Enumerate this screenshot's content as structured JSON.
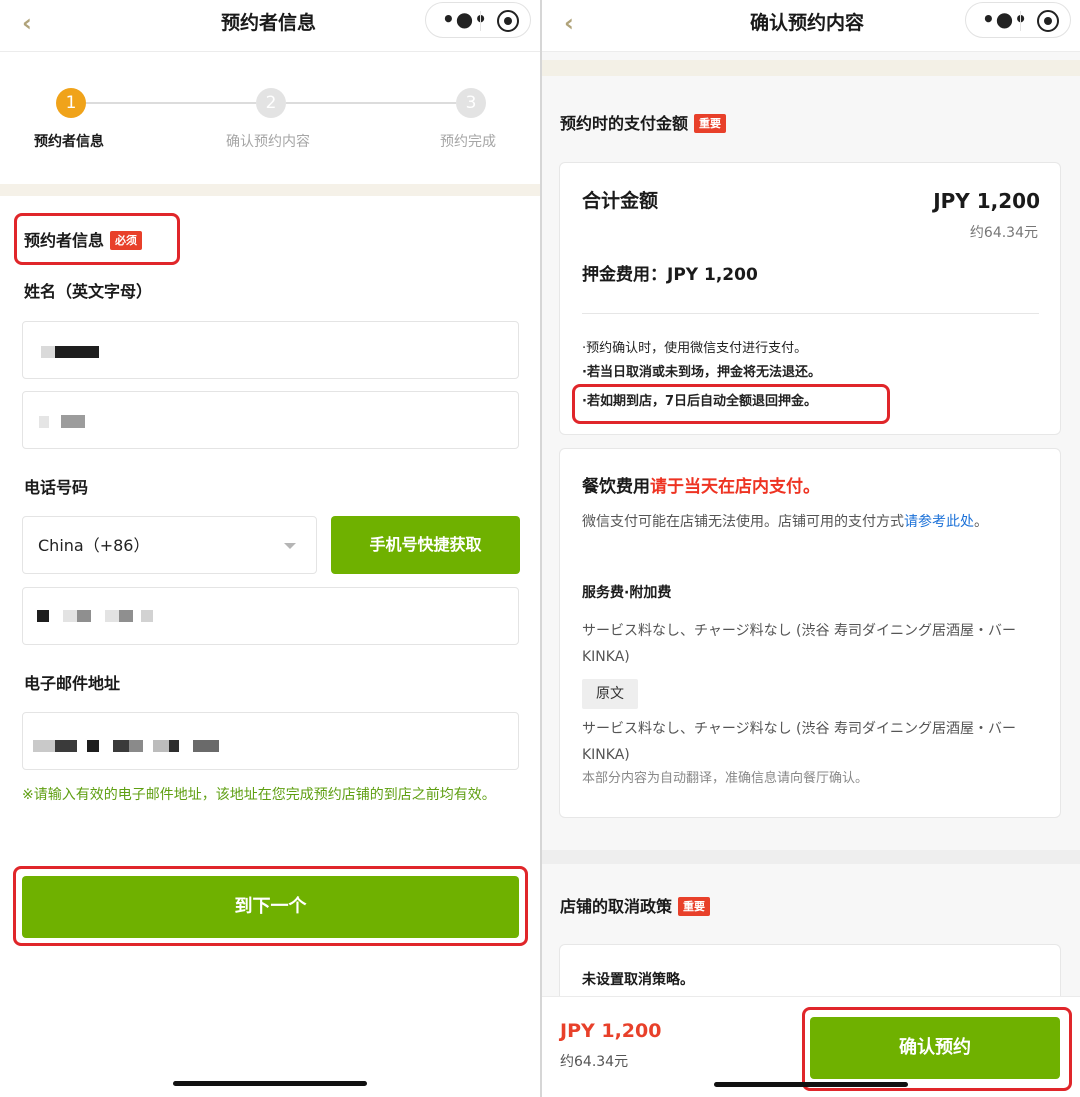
{
  "left": {
    "nav_title": "预约者信息",
    "steps": [
      {
        "num": "1",
        "label": "预约者信息",
        "active": true
      },
      {
        "num": "2",
        "label": "确认预约内容",
        "active": false
      },
      {
        "num": "3",
        "label": "预约完成",
        "active": false
      }
    ],
    "booker_section_title": "预约者信息",
    "required_tag": "必须",
    "name_label": "姓名（英文字母）",
    "phone_label": "电话号码",
    "country_code_value": "China（+86）",
    "quick_phone_button": "手机号快捷获取",
    "email_label": "电子邮件地址",
    "email_note": "※请输入有效的电子邮件地址，该地址在您完成预约店铺的到店之前均有效。",
    "next_button": "到下一个"
  },
  "right": {
    "nav_title": "确认预约内容",
    "payment_section_title": "预约时的支付金额",
    "important_tag": "重要",
    "total_label": "合计金额",
    "total_value": "JPY 1,200",
    "total_cny": "约64.34元",
    "deposit_label": "押金费用：JPY 1,200",
    "notes": [
      "·预约确认时，使用微信支付进行支付。",
      "·若当日取消或未到场，押金将无法退还。",
      "·若如期到店，7日后自动全额退回押金。"
    ],
    "food_fee_label": "餐饮费用",
    "food_fee_red": "请于当天在店内支付。",
    "wechat_note": "微信支付可能在店铺无法使用。店铺可用的支付方式",
    "wechat_link": "请参考此处",
    "wechat_note_end": "。",
    "service_fee_title": "服务费·附加费",
    "service_fee_text": "サービス料なし、チャージ料なし (渋谷 寿司ダイニング居酒屋・バーKINKA)",
    "original_button": "原文",
    "service_fee_original": "サービス料なし、チャージ料なし (渋谷 寿司ダイニング居酒屋・バーKINKA)",
    "auto_translate_note": "本部分内容为自动翻译，准确信息请向餐厅确认。",
    "cancel_section_title": "店铺的取消政策",
    "cancel_policy_text": "未设置取消策略。",
    "bottom_price": "JPY 1,200",
    "bottom_cny": "约64.34元",
    "confirm_button": "确认预约"
  },
  "colors": {
    "accent_green": "#6fb100",
    "step_active": "#f0a31a",
    "tag_red": "#e8402a",
    "highlight_red": "#e0262a",
    "link_blue": "#1d72d8",
    "note_green": "#5f9f12"
  },
  "icons": [
    "back-chevron-icon",
    "more-dots-icon",
    "target-circle-icon",
    "dropdown-caret-icon"
  ]
}
